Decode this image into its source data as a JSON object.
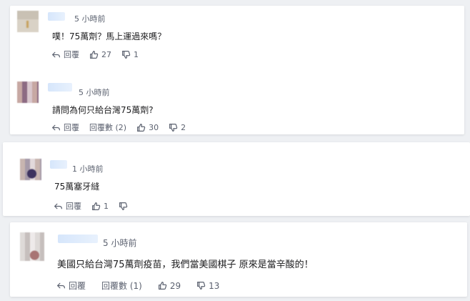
{
  "comments": [
    {
      "time": "5 小時前",
      "text": "噗！75萬劑？馬上運過來嗎？",
      "reply_label": "回覆",
      "likes": "27",
      "dislikes": "1"
    },
    {
      "time": "5 小時前",
      "text": "請問為何只給台灣75萬劑?",
      "reply_label": "回覆",
      "reply_count_label": "回覆數 (2)",
      "likes": "30",
      "dislikes": "2"
    },
    {
      "time": "1 小時前",
      "text": "75萬塞牙縫",
      "reply_label": "回覆",
      "likes": "1",
      "dislikes": ""
    },
    {
      "time": "5 小時前",
      "text": "美國只給台灣75萬劑疫苗，我們當美國棋子 原來是當辛酸的！",
      "reply_label": "回覆",
      "reply_count_label": "回覆數 (1)",
      "likes": "29",
      "dislikes": "13"
    }
  ],
  "icons": {
    "reply": "reply-arrow-icon",
    "like": "thumbs-up-icon",
    "dislike": "thumbs-down-icon"
  },
  "colors": {
    "background": "#eef0f3",
    "card": "#ffffff",
    "meta_text": "#5c6270",
    "username_blur": "#d6e6fb"
  }
}
